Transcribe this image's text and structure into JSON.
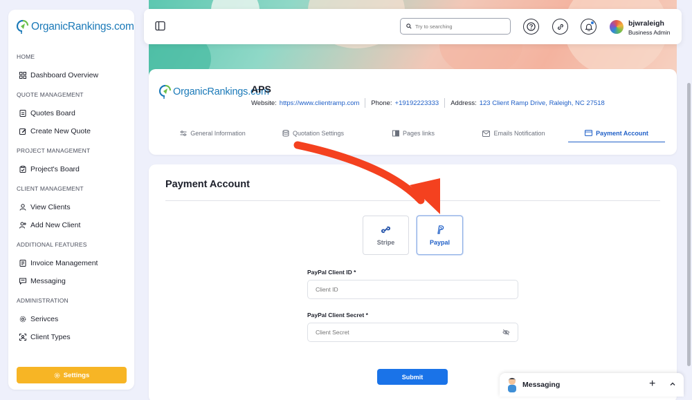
{
  "sidebar": {
    "logo_text": "OrganicRankings.com",
    "sections": [
      {
        "label": "HOME",
        "items": [
          {
            "label": "Dashboard Overview",
            "icon": "grid-icon"
          }
        ]
      },
      {
        "label": "QUOTE MANAGEMENT",
        "items": [
          {
            "label": "Quotes Board",
            "icon": "document-icon"
          },
          {
            "label": "Create New Quote",
            "icon": "edit-icon"
          }
        ]
      },
      {
        "label": "PROJECT MANAGEMENT",
        "items": [
          {
            "label": "Project's Board",
            "icon": "clipboard-icon"
          }
        ]
      },
      {
        "label": "CLIENT MANAGEMENT",
        "items": [
          {
            "label": "View Clients",
            "icon": "user-icon"
          },
          {
            "label": "Add New Client",
            "icon": "user-plus-icon"
          }
        ]
      },
      {
        "label": "ADDITIONAL FEATURES",
        "items": [
          {
            "label": "Invoice Management",
            "icon": "invoice-icon"
          },
          {
            "label": "Messaging",
            "icon": "message-icon"
          }
        ]
      },
      {
        "label": "ADMINISTRATION",
        "items": [
          {
            "label": "Serivces",
            "icon": "gear-icon"
          },
          {
            "label": "Client Types",
            "icon": "user-frame-icon"
          }
        ]
      }
    ],
    "settings_label": "Settings"
  },
  "topbar": {
    "search_placeholder": "Try to searching",
    "user_name": "bjwraleigh",
    "user_role": "Business Admin"
  },
  "company": {
    "logo_text": "OrganicRankings.com",
    "name": "APS",
    "website_label": "Website:",
    "website": "https://www.clientramp.com",
    "phone_label": "Phone:",
    "phone": "+19192223333",
    "address_label": "Address:",
    "address": "123 Client Ramp Drive, Raleigh, NC 27518"
  },
  "tabs": [
    {
      "label": "General Information",
      "icon": "sliders-icon",
      "active": false
    },
    {
      "label": "Quotation Settings",
      "icon": "database-icon",
      "active": false
    },
    {
      "label": "Pages links",
      "icon": "book-icon",
      "active": false
    },
    {
      "label": "Emails Notification",
      "icon": "mail-icon",
      "active": false
    },
    {
      "label": "Payment Account",
      "icon": "card-icon",
      "active": true
    }
  ],
  "payment": {
    "title": "Payment Account",
    "gateways": [
      {
        "label": "Stripe",
        "icon": "stripe-icon",
        "active": false
      },
      {
        "label": "Paypal",
        "icon": "paypal-icon",
        "active": true
      }
    ],
    "client_id_label": "PayPal Client ID *",
    "client_id_placeholder": "Client ID",
    "client_secret_label": "PayPal Client Secret *",
    "client_secret_placeholder": "Client Secret",
    "submit_label": "Submit"
  },
  "messaging": {
    "label": "Messaging"
  },
  "colors": {
    "primary": "#1a73e8",
    "accent": "#f7b525",
    "annotation_arrow": "#f4411f"
  }
}
